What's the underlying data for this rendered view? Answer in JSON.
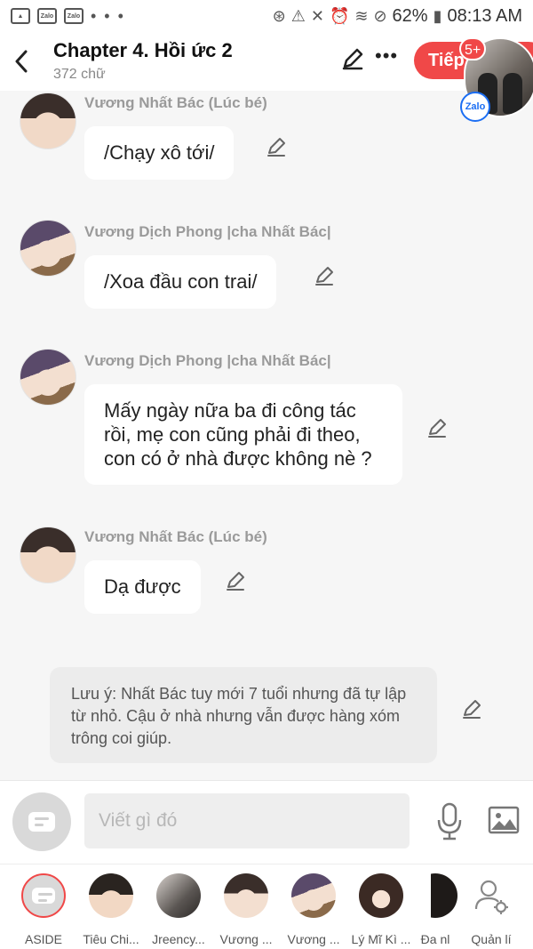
{
  "status_bar": {
    "left_icons": [
      "image-icon",
      "zalo-icon",
      "zalo-icon"
    ],
    "more": "• • •",
    "battery": "62%",
    "time": "08:13 AM"
  },
  "header": {
    "title": "Chapter 4. Hồi ức 2",
    "subtitle": "372 chữ",
    "next_label": "Tiếp",
    "badge_count": "5+",
    "zalo_label": "Zalo"
  },
  "messages": [
    {
      "sender": "Vương Nhất Bác (Lúc bé)",
      "text": "/Chạy xô tới/"
    },
    {
      "sender": "Vương Dịch Phong |cha Nhất Bác|",
      "text": "/Xoa đầu con trai/"
    },
    {
      "sender": "Vương Dịch Phong |cha Nhất Bác|",
      "text": "Mấy ngày nữa ba đi công tác\nrồi, mẹ con cũng phải đi theo,\ncon có ở nhà được không nè ?"
    },
    {
      "sender": "Vương Nhất Bác (Lúc bé)",
      "text": "Dạ được"
    }
  ],
  "note": "Lưu ý: Nhất Bác tuy mới 7 tuổi nhưng đã tự lập từ nhỏ. Cậu ở nhà nhưng vẫn được hàng xóm trông coi giúp.",
  "input": {
    "placeholder": "Viết gì đó"
  },
  "characters": [
    {
      "name": "ASIDE"
    },
    {
      "name": "Tiêu Chi..."
    },
    {
      "name": "Jreency..."
    },
    {
      "name": "Vương ..."
    },
    {
      "name": "Vương ..."
    },
    {
      "name": "Lý Mĩ Kì ..."
    },
    {
      "name": "Đa nl"
    },
    {
      "name": "Quản lí"
    }
  ],
  "colors": {
    "accent": "#f04848",
    "bubble": "#ffffff",
    "background": "#f6f6f6",
    "note": "#ececec"
  }
}
